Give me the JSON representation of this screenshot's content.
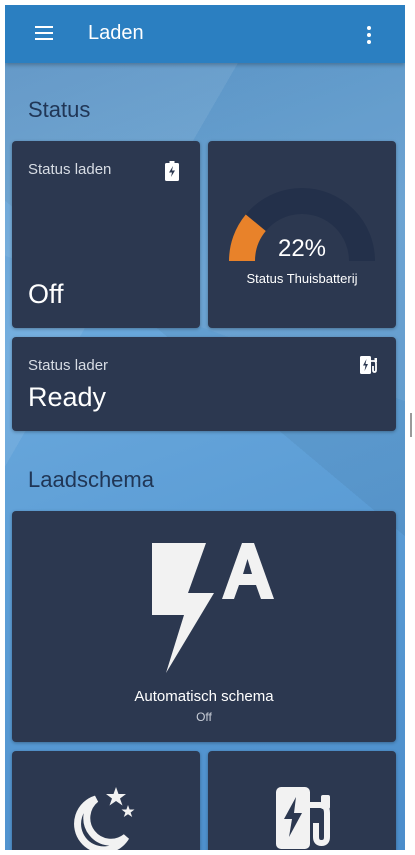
{
  "header": {
    "title": "Laden",
    "menu_icon": "hamburger-menu-icon",
    "more_icon": "more-vertical-icon"
  },
  "sections": {
    "status": "Status",
    "schedule": "Laadschema"
  },
  "cards": {
    "charging_status": {
      "label": "Status laden",
      "value": "Off",
      "icon": "battery-charging-icon"
    },
    "home_battery": {
      "value": "22%",
      "label": "Status Thuisbatterij",
      "percent": 22,
      "fill_color": "#e8822a",
      "track_color": "#23304a"
    },
    "charger_status": {
      "label": "Status lader",
      "value": "Ready",
      "icon": "ev-station-icon"
    },
    "auto_schedule": {
      "label": "Automatisch schema",
      "state": "Off",
      "icon": "flash-auto-icon"
    },
    "night_schedule": {
      "icon": "weather-night-icon"
    },
    "charger_schedule": {
      "icon": "ev-station-icon"
    }
  },
  "colors": {
    "header": "#2b7fc1",
    "card": "#2c3850",
    "section_title": "#203656"
  }
}
